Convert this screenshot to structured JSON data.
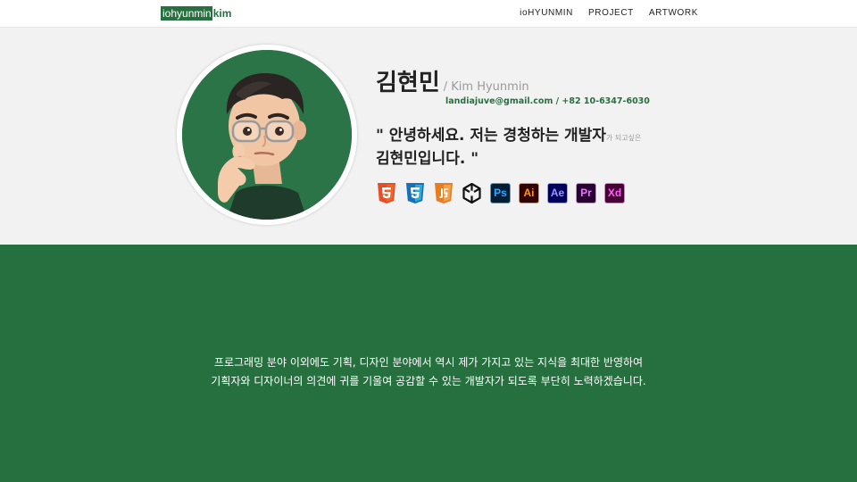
{
  "navbar": {
    "logo_main": "iohyunmin",
    "logo_accent": "kim",
    "links": [
      "ioHYUNMIN",
      "PROJECT",
      "ARTWORK"
    ]
  },
  "profile": {
    "name_ko": "김현민",
    "name_en": "/ Kim Hyunmin",
    "contact": "landiajuve@gmail.com / +82 10-6347-6030",
    "quote_line1_main": "\" 안녕하세요. 저는 경청하는 개발자",
    "quote_line1_small": "가 되고싶은",
    "quote_line2": "김현민입니다. \"",
    "skills": [
      {
        "icon": "html5-icon"
      },
      {
        "icon": "css3-icon"
      },
      {
        "icon": "javascript-icon"
      },
      {
        "icon": "unity-icon"
      },
      {
        "icon": "photoshop-icon",
        "label": "Ps",
        "bg": "#001e36",
        "fg": "#31a8ff"
      },
      {
        "icon": "illustrator-icon",
        "label": "Ai",
        "bg": "#330000",
        "fg": "#ff9a00"
      },
      {
        "icon": "after-effects-icon",
        "label": "Ae",
        "bg": "#00005b",
        "fg": "#9999ff"
      },
      {
        "icon": "premiere-icon",
        "label": "Pr",
        "bg": "#2a0033",
        "fg": "#ea77ff"
      },
      {
        "icon": "xd-icon",
        "label": "Xd",
        "bg": "#470137",
        "fg": "#ff61f6"
      }
    ]
  },
  "about": {
    "line1": "프로그래밍 분야 이외에도 기획, 디자인 분야에서 역시 제가 가지고 있는 지식을 최대한 반영하여",
    "line2": "기획자와 디자이너의 의견에 귀를 기울여 공감할 수 있는 개발자가 되도록 부단히 노력하겠습니다."
  },
  "colors": {
    "brand_green": "#26703f",
    "hero_bg": "#f2f2f2"
  }
}
